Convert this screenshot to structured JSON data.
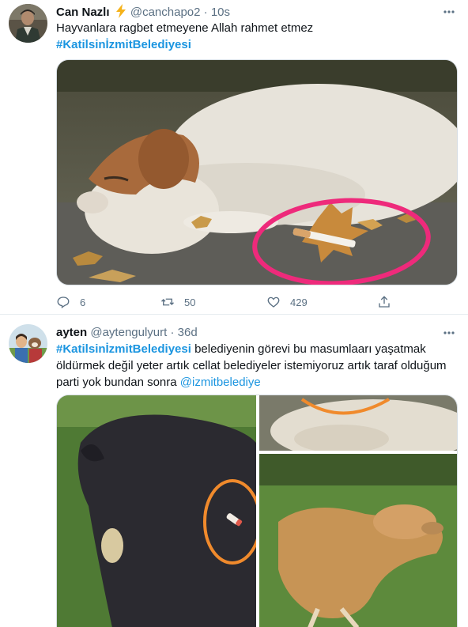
{
  "tweets": [
    {
      "name": "Can Nazlı",
      "handle": "@canchapo2",
      "sep": "·",
      "time": "10s",
      "line1": "Hayvanlara ragbet etmeyene Allah rahmet etmez",
      "hashtag": "#KatilsinİzmitBelediyesi",
      "actions": {
        "reply": "6",
        "retweet": "50",
        "like": "429"
      }
    },
    {
      "name": "ayten",
      "handle": "@aytengulyurt",
      "sep": "·",
      "time": "36d",
      "hashtag": "#KatilsinİzmitBelediyesi",
      "body": " belediyenin görevi bu masumlaarı yaşatmak öldürmek değil yeter artık cellat  belediyeler istemiyoruz artık  taraf olduğum parti yok bundan sonra ",
      "mention": "@izmitbelediye"
    }
  ],
  "colors": {
    "accent": "#1b95e0",
    "muted": "#5b7083",
    "text": "#0f1419",
    "border": "#e6ecf0",
    "highlight_pink": "#ee2a7b",
    "highlight_orange": "#f08a2c"
  }
}
